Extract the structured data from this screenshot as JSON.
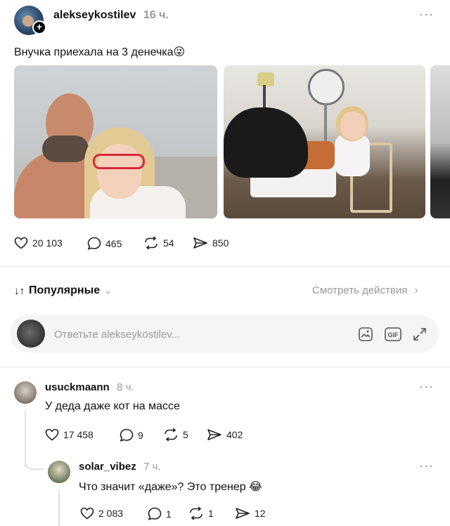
{
  "post": {
    "username": "alekseykostilev",
    "time": "16 ч.",
    "more": "···",
    "text": "Внучка приехала на 3 денечка",
    "text_emoji": "😜",
    "stats": {
      "likes": "20 103",
      "comments": "465",
      "reposts": "54",
      "shares": "850"
    }
  },
  "sort": {
    "label": "Популярные",
    "icon": "↓↑",
    "chevron": "⌄"
  },
  "activity_link": "Смотреть действия",
  "activity_chevron": "›",
  "reply": {
    "placeholder": "Ответьте alekseykostilev..."
  },
  "comments": [
    {
      "username": "usuckmaann",
      "time": "8 ч.",
      "text": "У деда даже кот на массе",
      "stats": {
        "likes": "17 458",
        "comments": "9",
        "reposts": "5",
        "shares": "402"
      }
    },
    {
      "username": "solar_vibez",
      "time": "7 ч.",
      "text": "Что значит «даже»? Это тренер",
      "emoji": "😂",
      "stats": {
        "likes": "2 083",
        "comments": "1",
        "reposts": "1",
        "shares": "12"
      }
    }
  ]
}
